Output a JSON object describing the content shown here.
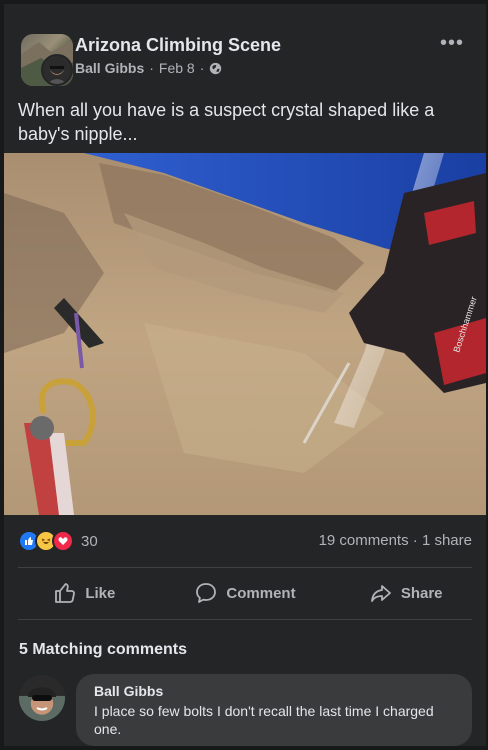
{
  "post": {
    "group_name": "Arizona Climbing Scene",
    "author": "Ball Gibbs",
    "date": "Feb 8",
    "separator": "·",
    "text": "When all you have is a suspect crystal shaped like a baby's nipple...",
    "more_label": "•••"
  },
  "photo": {
    "drill_label": "Boschhammer"
  },
  "reactions": {
    "count": "30",
    "comments": "19 comments",
    "shares": "1 share",
    "dot": "·",
    "types": [
      "like-icon",
      "haha-icon",
      "love-icon"
    ]
  },
  "actions": [
    {
      "label": "Like",
      "icon": "thumbs-up-icon"
    },
    {
      "label": "Comment",
      "icon": "comment-icon"
    },
    {
      "label": "Share",
      "icon": "share-arrow-icon"
    }
  ],
  "comments": {
    "heading": "5 Matching comments",
    "items": [
      {
        "author": "Ball Gibbs",
        "text": "I place so few bolts I don't recall the last time I charged one."
      }
    ]
  },
  "colors": {
    "background": "#18191a",
    "card": "#242526",
    "text_primary": "#e4e6eb",
    "text_secondary": "#b0b3b8",
    "comment_bubble": "#3a3b3c",
    "like_blue": "#2078f4",
    "love_red": "#f0284a",
    "haha_yellow": "#f7c644"
  }
}
